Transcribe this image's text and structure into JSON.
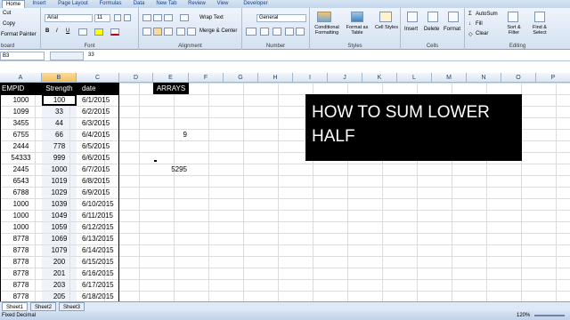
{
  "tabs": [
    "Home",
    "Insert",
    "Page Layout",
    "Formulas",
    "Data",
    "New Tab",
    "Review",
    "View",
    "Developer"
  ],
  "clipboard": {
    "cut": "Cut",
    "copy": "Copy",
    "format_painter": "Format Painter",
    "label": "board"
  },
  "font": {
    "name": "Arial",
    "size": "11",
    "label": "Font"
  },
  "alignment": {
    "wrap": "Wrap Text",
    "merge": "Merge & Center",
    "label": "Alignment"
  },
  "number": {
    "format": "General",
    "label": "Number"
  },
  "styles": {
    "conditional": "Conditional Formatting",
    "format_table": "Format as Table",
    "cell_styles": "Cell Styles",
    "label": "Styles"
  },
  "cells": {
    "insert": "Insert",
    "delete": "Delete",
    "format": "Format",
    "label": "Cells"
  },
  "editing": {
    "autosum": "AutoSum",
    "fill": "Fill",
    "clear": "Clear",
    "sort": "Sort & Filter",
    "find": "Find & Select",
    "label": "Editing"
  },
  "formula_bar": {
    "name_box": "B3",
    "value": "33"
  },
  "columns": [
    "A",
    "B",
    "C",
    "D",
    "E",
    "F",
    "G",
    "H",
    "I",
    "J",
    "K",
    "L",
    "M",
    "N",
    "O",
    "P"
  ],
  "selected_column": "B",
  "table": {
    "headers": [
      "EMPID",
      "Strength",
      "date"
    ],
    "rows": [
      [
        "1000",
        "100",
        "6/1/2015"
      ],
      [
        "1099",
        "33",
        "6/2/2015"
      ],
      [
        "3455",
        "44",
        "6/3/2015"
      ],
      [
        "6755",
        "66",
        "6/4/2015"
      ],
      [
        "2444",
        "778",
        "6/5/2015"
      ],
      [
        "54333",
        "999",
        "6/6/2015"
      ],
      [
        "2445",
        "1000",
        "6/7/2015"
      ],
      [
        "6543",
        "1019",
        "6/8/2015"
      ],
      [
        "6788",
        "1029",
        "6/9/2015"
      ],
      [
        "1000",
        "1039",
        "6/10/2015"
      ],
      [
        "1000",
        "1049",
        "6/11/2015"
      ],
      [
        "1000",
        "1059",
        "6/12/2015"
      ],
      [
        "8778",
        "1069",
        "6/13/2015"
      ],
      [
        "8778",
        "1079",
        "6/14/2015"
      ],
      [
        "8778",
        "200",
        "6/15/2015"
      ],
      [
        "8778",
        "201",
        "6/16/2015"
      ],
      [
        "8778",
        "203",
        "6/17/2015"
      ],
      [
        "8778",
        "205",
        "6/18/2015"
      ]
    ]
  },
  "arrays_label": "ARRAYS",
  "values": {
    "e5": "9",
    "e8": "5295"
  },
  "banner_text": "HOW TO SUM LOWER HALF",
  "sheets": [
    "Sheet1",
    "Sheet2",
    "Sheet3"
  ],
  "status": {
    "mode": "Fixed Decimal",
    "zoom": "120%"
  },
  "colors": {
    "selection": "#f1c15f",
    "banner": "#000000",
    "ribbon": "#d4e1f1"
  }
}
